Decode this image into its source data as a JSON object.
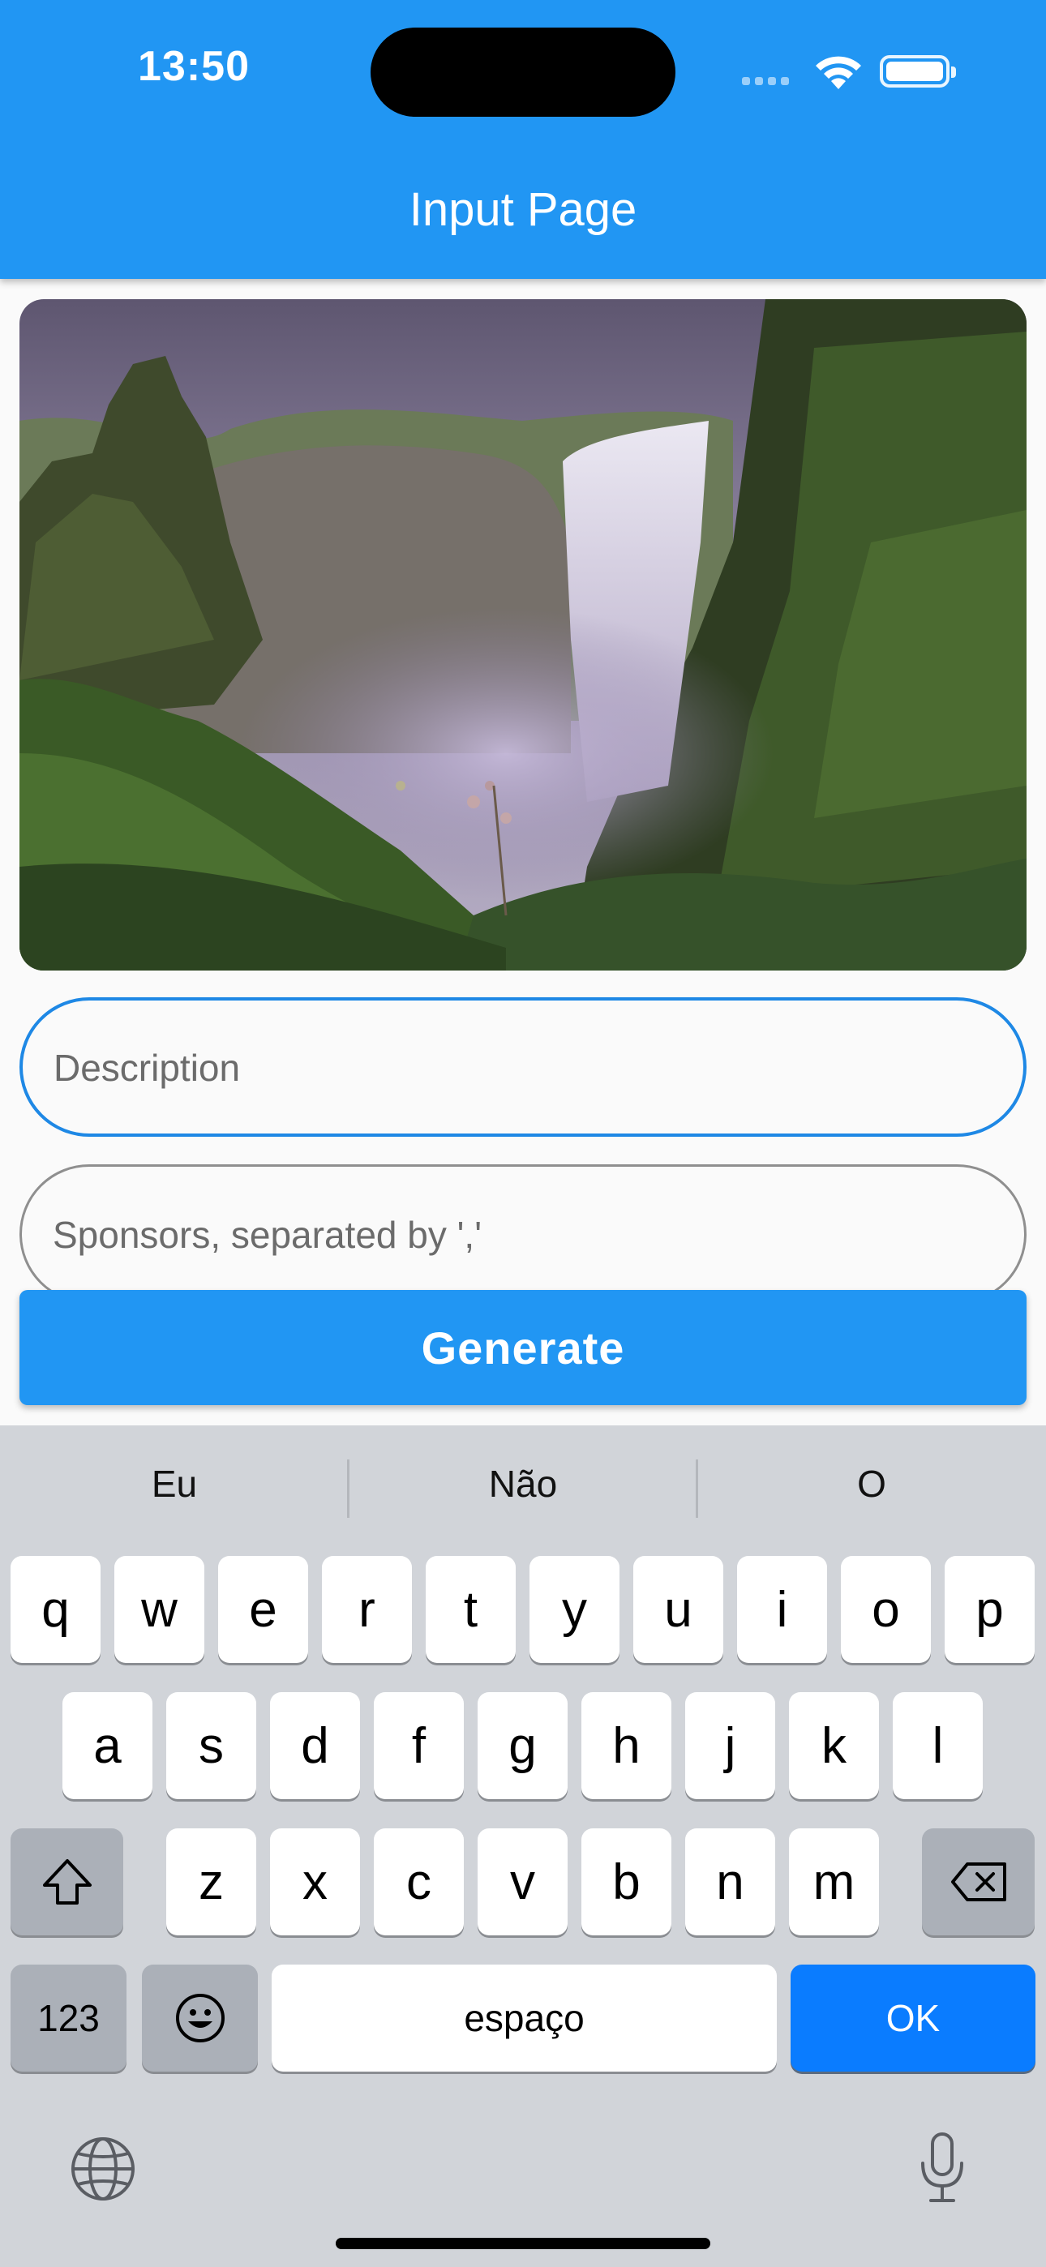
{
  "status_bar": {
    "time": "13:50",
    "wifi_icon": "wifi-icon",
    "battery_icon": "battery-icon"
  },
  "app_bar": {
    "title": "Input Page",
    "color": "#2196F3"
  },
  "image": {
    "icon": "waterfall-landscape-photo"
  },
  "form": {
    "description": {
      "placeholder": "Description",
      "value": ""
    },
    "sponsors": {
      "placeholder": "Sponsors, separated by ','",
      "value": ""
    },
    "generate_label": "Generate"
  },
  "keyboard": {
    "suggestions": [
      "Eu",
      "Não",
      "O"
    ],
    "row1": [
      "q",
      "w",
      "e",
      "r",
      "t",
      "y",
      "u",
      "i",
      "o",
      "p"
    ],
    "row2": [
      "a",
      "s",
      "d",
      "f",
      "g",
      "h",
      "j",
      "k",
      "l"
    ],
    "row3": [
      "z",
      "x",
      "c",
      "v",
      "b",
      "n",
      "m"
    ],
    "numbers_label": "123",
    "space_label": "espaço",
    "return_label": "OK",
    "return_color": "#0A7CFF"
  }
}
